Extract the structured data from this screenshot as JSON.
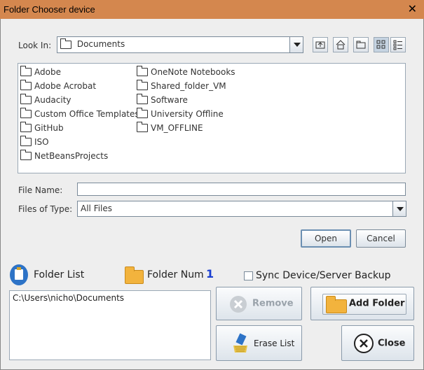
{
  "window": {
    "title": "Folder Chooser device",
    "close_glyph": "✕"
  },
  "chooser": {
    "look_in_label": "Look In:",
    "look_in_value": "Documents",
    "toolbar_icons": [
      "up-one-level-icon",
      "home-icon",
      "new-folder-icon",
      "list-view-icon",
      "details-view-icon"
    ],
    "folders": [
      "Adobe",
      "Adobe Acrobat",
      "Audacity",
      "Custom Office Templates",
      "GitHub",
      "ISO",
      "NetBeansProjects",
      "OneNote Notebooks",
      "Shared_folder_VM",
      "Software",
      "University Offline",
      "VM_OFFLINE"
    ],
    "file_name_label": "File Name:",
    "file_name_value": "",
    "files_of_type_label": "Files of Type:",
    "files_of_type_value": "All Files",
    "open_label": "Open",
    "cancel_label": "Cancel"
  },
  "bottom": {
    "folder_list_label": "Folder List",
    "folder_num_label": "Folder Num",
    "folder_num_value": "1",
    "folder_num_color": "#1a3fd1",
    "sync_label": "Sync Device/Server Backup",
    "sync_checked": false,
    "paths": [
      "C:\\Users\\nicho\\Documents"
    ],
    "remove_label": "Remove",
    "add_folder_label": "Add Folder",
    "erase_list_label": "Erase List",
    "close_label": "Close"
  }
}
